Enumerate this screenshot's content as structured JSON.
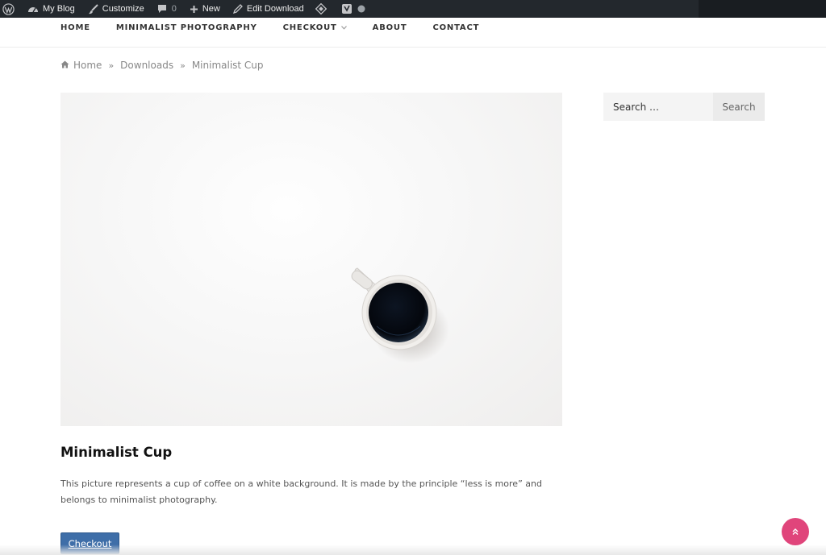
{
  "adminbar": {
    "site_name": "My Blog",
    "customize": "Customize",
    "comments_count": "0",
    "new_label": "New",
    "edit_label": "Edit Download"
  },
  "nav": {
    "items": [
      "HOME",
      "MINIMALIST PHOTOGRAPHY",
      "CHECKOUT",
      "ABOUT",
      "CONTACT"
    ]
  },
  "breadcrumb": {
    "home": "Home",
    "sep": "»",
    "downloads": "Downloads",
    "current": "Minimalist Cup"
  },
  "post": {
    "title": "Minimalist Cup",
    "body": "This picture represents a cup of coffee on a white background. It is made by the principle “less is more” and belongs to minimalist photography.",
    "button": "Checkout"
  },
  "search": {
    "placeholder": "Search …",
    "button": "Search"
  },
  "colors": {
    "accent": "#e0457b",
    "button": "#3e6ea8",
    "adminbar": "#23282d"
  }
}
